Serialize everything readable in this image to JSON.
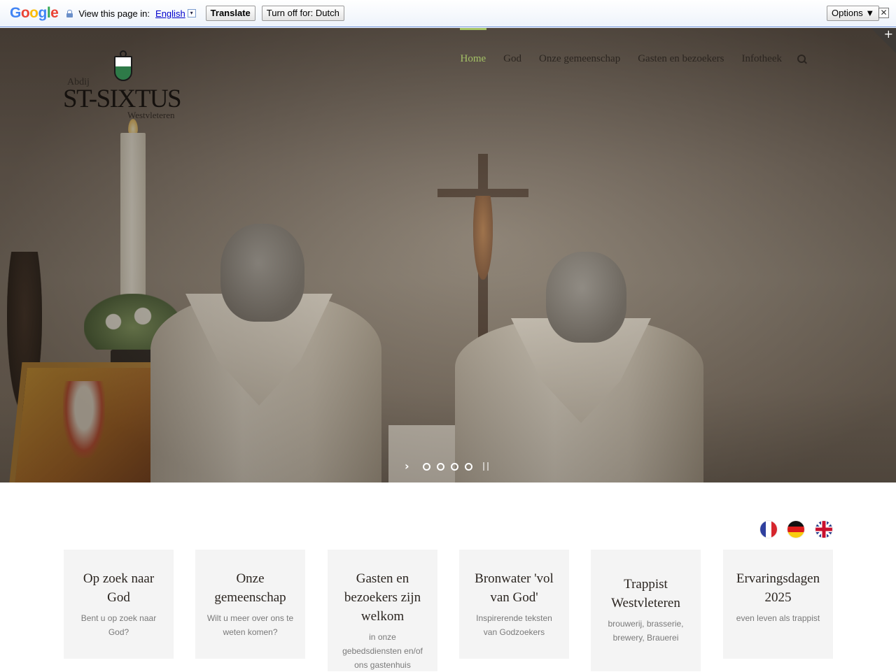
{
  "translate_bar": {
    "logo_text": "Google",
    "view_text": "View this page in:",
    "language": "English",
    "dropdown_arrow": "▾",
    "translate_label": "Translate",
    "turn_off_label": "Turn off for: Dutch",
    "options_label": "Options ▼",
    "close_symbol": "✕"
  },
  "logo": {
    "top_text": "Abdij",
    "name": "ST-SIXTUS",
    "subtitle": "Westvleteren"
  },
  "nav": {
    "items": [
      {
        "label": "Home",
        "active": true
      },
      {
        "label": "God",
        "active": false
      },
      {
        "label": "Onze gemeenschap",
        "active": false
      },
      {
        "label": "Gasten en bezoekers",
        "active": false
      },
      {
        "label": "Infotheek",
        "active": false
      }
    ],
    "search_icon": "search-icon"
  },
  "hero": {
    "corner_symbol": "+",
    "slider_next": "›",
    "slide_count": 4
  },
  "languages": [
    "fr",
    "de",
    "en"
  ],
  "cards": [
    {
      "title": "Op zoek naar God",
      "text": "Bent u op zoek naar God?"
    },
    {
      "title": "Onze gemeenschap",
      "text": "Wilt u meer over ons te weten komen?"
    },
    {
      "title": "Gasten en bezoekers zijn welkom",
      "text": "in onze gebedsdiensten en/of ons gastenhuis"
    },
    {
      "title": "Bronwater 'vol van God'",
      "text": "Inspirerende teksten van Godzoekers"
    },
    {
      "title": "Trappist Westvleteren",
      "text": "brouwerij, brasserie, brewery, Brauerei"
    },
    {
      "title": "Ervaringsdagen 2025",
      "text": "even leven als trappist"
    }
  ],
  "colors": {
    "accent": "#a4c266",
    "card_bg": "#f4f4f4"
  }
}
